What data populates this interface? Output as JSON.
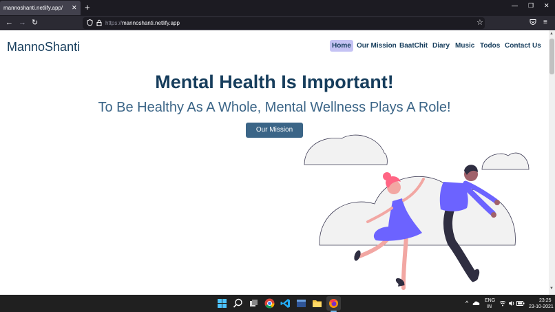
{
  "browser": {
    "tab_title": "mannoshanti.netlify.app/",
    "tab_close": "✕",
    "new_tab": "+",
    "url_protocol": "https://",
    "url_host": "mannoshanti.netlify.app"
  },
  "site": {
    "brand": "MannoShanti",
    "nav": [
      "Home",
      "Our Mission",
      "BaatChit",
      "Diary",
      "Music",
      "Todos",
      "Contact Us"
    ],
    "hero_title": "Mental Health Is Important!",
    "hero_subtitle": "To Be Healthy As A Whole, Mental Wellness Plays A Role!",
    "cta_label": "Our Mission"
  },
  "taskbar": {
    "lang_top": "ENG",
    "lang_bottom": "IN",
    "time": "23:25",
    "date": "23-10-2021"
  },
  "colors": {
    "primary": "#163d5c",
    "secondary": "#3b6587",
    "nav_active_bg": "#c5c3f4",
    "illus_purple": "#6c63ff",
    "illus_pink": "#ff6584"
  }
}
